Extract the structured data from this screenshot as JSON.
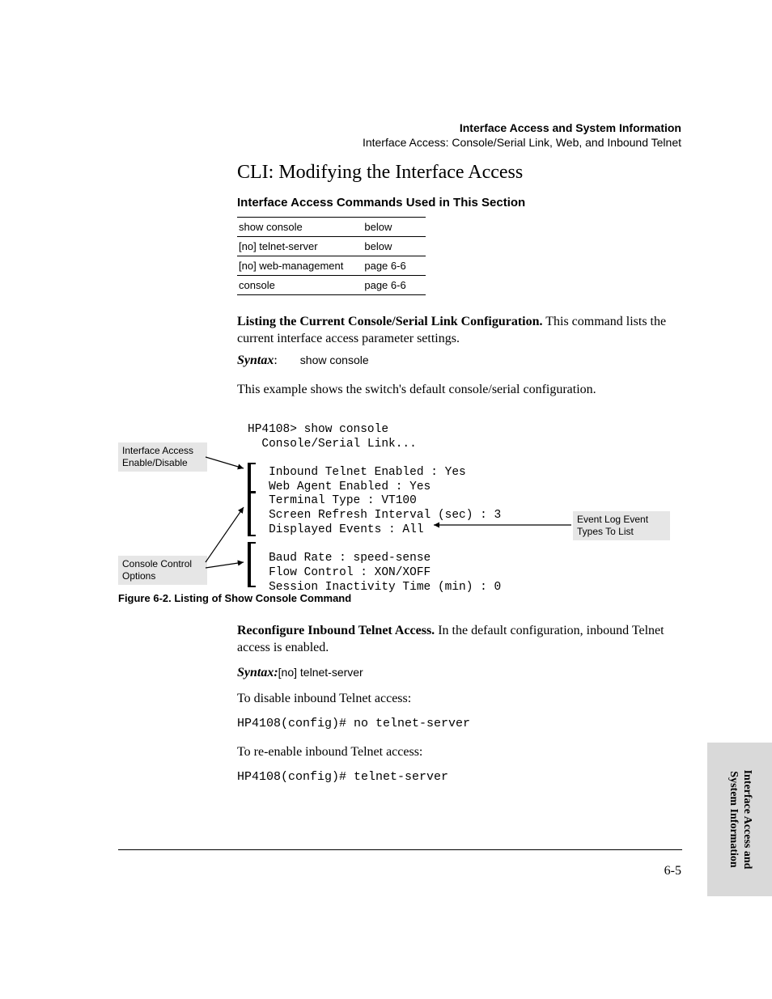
{
  "header": {
    "title": "Interface Access and System Information",
    "subtitle": "Interface Access: Console/Serial Link, Web, and Inbound Telnet"
  },
  "section_heading": "CLI: Modifying the Interface Access",
  "table_title": "Interface Access Commands Used in This Section",
  "commands": [
    {
      "cmd": "show console",
      "ref": "below"
    },
    {
      "cmd": "[no] telnet-server",
      "ref": "below"
    },
    {
      "cmd": "[no] web-management",
      "ref": "page 6-6"
    },
    {
      "cmd": "console",
      "ref": "page 6-6"
    }
  ],
  "para1_bold": "Listing the Current Console/Serial Link Configuration.",
  "para1_rest": "  This command lists the current interface access parameter settings.",
  "syntax1_label": "Syntax",
  "syntax1_cmd": "show console",
  "para2": "This example shows the switch's default console/serial configuration.",
  "callouts": {
    "c1": "Interface Access Enable/Disable",
    "c2": "Console Control Options",
    "c3": "Event Log Event Types To List"
  },
  "terminal": "HP4108> show console\n  Console/Serial Link...\n\n   Inbound Telnet Enabled : Yes\n   Web Agent Enabled : Yes\n   Terminal Type : VT100\n   Screen Refresh Interval (sec) : 3\n   Displayed Events : All\n\n   Baud Rate : speed-sense\n   Flow Control : XON/XOFF\n   Session Inactivity Time (min) : 0",
  "figure_caption": "Figure 6-2.  Listing of Show Console Command",
  "para3_bold": "Reconfigure Inbound Telnet Access.",
  "para3_rest": "  In the default configuration, inbound Telnet access is enabled.",
  "syntax2_label": "Syntax:",
  "syntax2_cmd": "[no] telnet-server",
  "para5": "To disable inbound Telnet access:",
  "code1": "HP4108(config)# no telnet-server",
  "para6": "To re-enable inbound Telnet access:",
  "code2": "HP4108(config)# telnet-server",
  "page_number": "6-5",
  "side_tab_line1": "Interface Access and",
  "side_tab_line2": "System Information"
}
